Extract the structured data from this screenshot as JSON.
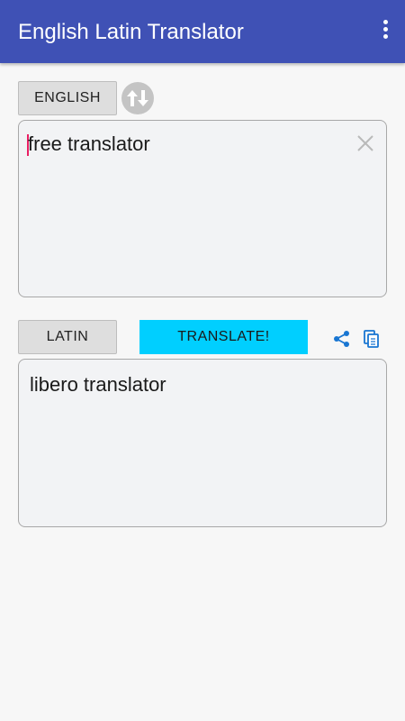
{
  "app": {
    "title": "English Latin Translator",
    "menu_icon": "more-vert-icon"
  },
  "source": {
    "language_label": "ENGLISH",
    "text": "free translator",
    "clear_icon": "close-icon"
  },
  "swap": {
    "icon": "swap-vertical-icon"
  },
  "target": {
    "language_label": "LATIN",
    "text": "libero translator"
  },
  "actions": {
    "translate_label": "TRANSLATE!",
    "share_icon": "share-icon",
    "copy_icon": "copy-icon"
  },
  "colors": {
    "toolbar": "#3f51b5",
    "translate_button": "#00cfff",
    "action_icons": "#1976d2",
    "caret": "#e91e63"
  }
}
